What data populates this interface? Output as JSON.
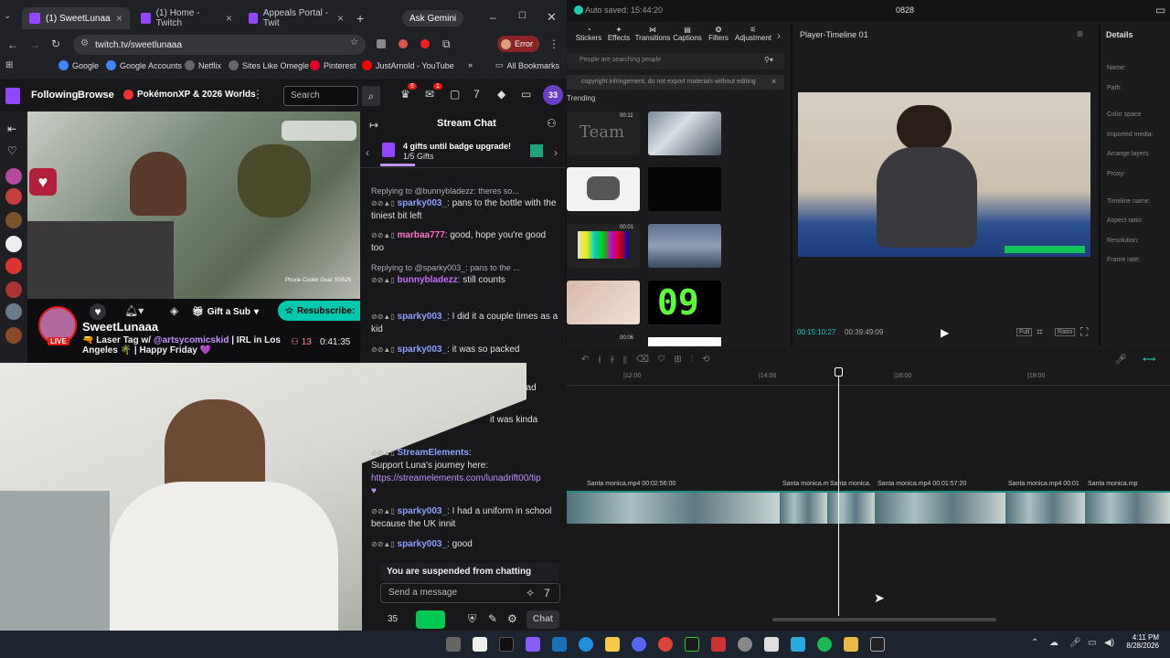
{
  "browser": {
    "tabs": [
      {
        "label": "(1) SweetLunaa",
        "active": true
      },
      {
        "label": "(1) Home - Twitch",
        "active": false
      },
      {
        "label": "Appeals Portal - Twit",
        "active": false
      }
    ],
    "gemini": "Ask Gemini",
    "url": "twitch.tv/sweetlunaaa",
    "error_label": "Error",
    "bookmarks": [
      "Google",
      "Google Accounts",
      "Netflix",
      "Sites Like Omegle",
      "Pinterest",
      "JustArnold - YouTube"
    ],
    "all_bookmarks": "All Bookmarks"
  },
  "twitch": {
    "nav": {
      "following": "Following",
      "browse": "Browse",
      "pinned": "PokémonXP & 2026 Worlds",
      "search_placeholder": "Search",
      "badge1": "6",
      "badge2": "1",
      "avatar": "33"
    },
    "stream": {
      "channel": "SweetLunaaa",
      "live": "LIVE",
      "title_prefix": "🔫 Laser Tag w/",
      "mention": "@artsycomicskid",
      "title_suffix": "| IRL in Los",
      "title_line2": "Angeles 🌴 | Happy Friday 💜",
      "viewers": "13",
      "uptime": "0:41:35",
      "gift_sub": "Gift a Sub",
      "resubscribe": "Resubscribe:",
      "overlay_a": "Phone Cooler Goal",
      "overlay_b": "50/525"
    },
    "chat": {
      "header": "Stream Chat",
      "gift_title": "4 gifts until badge upgrade!",
      "gift_sub": "1/5 Gifts",
      "messages": [
        {
          "reply": "Replying to @bunnybladezz: theres so...",
          "user": "sparky003_",
          "text": ": pans to the bottle with the tiniest bit left",
          "color": "#8c9eff"
        },
        {
          "reply": "",
          "user": "marbaa777",
          "text": ": good, hope you're good too",
          "color": "#ff6ec7"
        },
        {
          "reply": "Replying to @sparky003_: pans to the ...",
          "user": "bunnybladezz",
          "text": ": still counts",
          "color": "#c46bff"
        },
        {
          "reply": "",
          "user": "sparky003_",
          "text": ": I did it a couple times as a kid",
          "color": "#8c9eff"
        },
        {
          "reply": "",
          "user": "sparky003_",
          "text": ": it was so packed",
          "color": "#8c9eff"
        }
      ],
      "partial1": "had",
      "partial2": "it was kinda",
      "se_user": "StreamElements",
      "se_text": "Support Luna's journey here:",
      "se_link": "https://streamelements.com/lunadrift00/tip",
      "msg_uniform_user": "sparky003_",
      "msg_uniform": ": I had a uniform in school because the UK innit",
      "msg_good_user": "sparky003_",
      "msg_good": ": good",
      "suspended": "You are suspended from chatting",
      "send_placeholder": "Send a message",
      "points": "35",
      "chat_btn": "Chat"
    }
  },
  "capcut": {
    "autosave": "Auto saved: 15:44:20",
    "project": "0828",
    "tools": [
      "Stickers",
      "Effects",
      "Transitions",
      "Captions",
      "Filters",
      "Adjustment"
    ],
    "search_placeholder": "People are searching people",
    "warning": "copyright infringement, do not export materials without editing",
    "trending": "Trending",
    "thumb_texts": [
      "Team",
      "09"
    ],
    "thumb_times": [
      "00:11",
      "00:01",
      "00:06"
    ],
    "player_title": "Player-Timeline 01",
    "details": "Details",
    "detail_fields": [
      "Name:",
      "Path:",
      "Color space",
      "Imported media:",
      "Arrange layers",
      "Proxy:",
      "Timeline name:",
      "Aspect ratio:",
      "Resolution:",
      "Frame rate:"
    ],
    "time_current": "00:15:10:27",
    "time_total": "00:39:49:09",
    "btn_full": "Full",
    "btn_ratio": "Ratio",
    "ruler": [
      "|12:00",
      "|14:00",
      "|16:00",
      "|18:00"
    ],
    "clips": [
      "Santa monica.mp4  00:02:56:00",
      "Santa monica.m",
      "Santa monica.",
      "Santa monica.mp4  00:01:57:20",
      "Santa monica.mp4  00:01",
      "Santa monica.mp"
    ]
  },
  "taskbar": {
    "time": "4:11 PM",
    "date": "8/28/2026"
  }
}
